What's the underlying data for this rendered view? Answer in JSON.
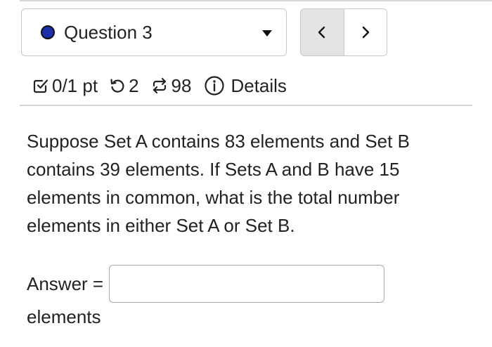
{
  "question_selector": {
    "label": "Question 3",
    "status_color": "#1a2fa8"
  },
  "navigation": {
    "prev_icon": "chevron-left-icon",
    "next_icon": "chevron-right-icon"
  },
  "meta": {
    "score": "0/1 pt",
    "attempts": "2",
    "versions": "98",
    "details_label": "Details"
  },
  "question": {
    "text": "Suppose Set A contains 83 elements and Set B contains 39 elements. If Sets A and B have 15 elements in common, what is the total number elements in either Set A or Set B."
  },
  "answer": {
    "label": "Answer =",
    "value": "",
    "unit": "elements"
  }
}
